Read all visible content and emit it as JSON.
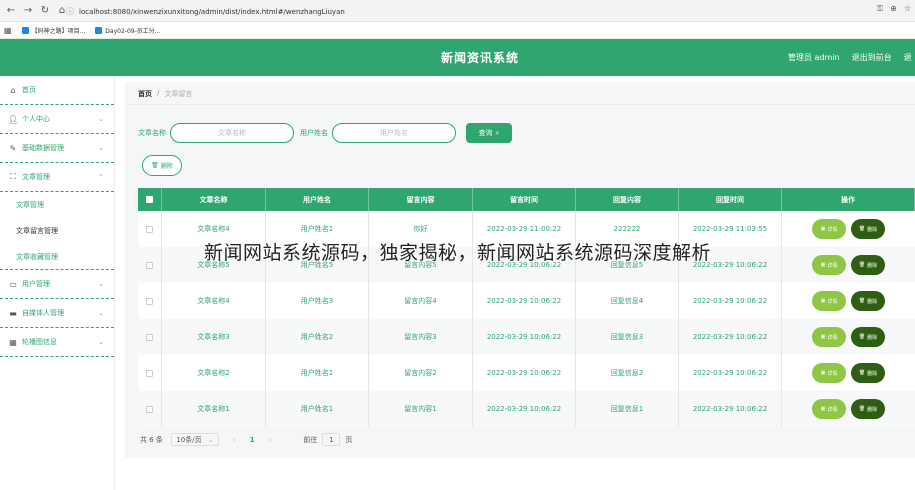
{
  "browser": {
    "url": "localhost:8080/xinwenzixunxitong/admin/dist/index.html#/wenzhangLiuyan",
    "bookmarks": [
      "【码神之路】项目...",
      "Day02-09-员工分..."
    ]
  },
  "header": {
    "title": "新闻资讯系统",
    "admin": "管理员 admin",
    "back_to_front": "退出到前台",
    "logout": "退"
  },
  "sidebar": {
    "items": [
      {
        "label": "首页",
        "icon": "home-icon"
      },
      {
        "label": "个人中心",
        "icon": "user-icon"
      },
      {
        "label": "基础数据管理",
        "icon": "edit-icon"
      },
      {
        "label": "文章管理",
        "icon": "expand-icon"
      },
      {
        "label": "用户管理",
        "icon": "monitor-icon"
      },
      {
        "label": "自媒体人管理",
        "icon": "media-icon"
      },
      {
        "label": "轮播图信息",
        "icon": "grid-icon"
      }
    ],
    "sub_items": [
      "文章管理",
      "文章留言管理",
      "文章收藏管理"
    ]
  },
  "breadcrumb": {
    "home": "首页",
    "sep": "/",
    "current": "文章留言"
  },
  "search": {
    "article_label": "文章名称",
    "article_placeholder": "文章名称",
    "user_label": "用户姓名",
    "user_placeholder": "用户姓名",
    "button": "查询"
  },
  "delete_button": "删除",
  "table": {
    "headers": [
      "文章名称",
      "用户姓名",
      "留言内容",
      "留言时间",
      "回复内容",
      "回复时间",
      "操作"
    ],
    "rows": [
      [
        "文章名称4",
        "用户姓名1",
        "你好",
        "2022-03-29 11:00:22",
        "222222",
        "2022-03-29 11:03:55"
      ],
      [
        "文章名称5",
        "用户姓名5",
        "留言内容5",
        "2022-03-29 10:06:22",
        "回复信息5",
        "2022-03-29 10:06:22"
      ],
      [
        "文章名称4",
        "用户姓名3",
        "留言内容4",
        "2022-03-29 10:06:22",
        "回复信息4",
        "2022-03-29 10:06:22"
      ],
      [
        "文章名称3",
        "用户姓名2",
        "留言内容3",
        "2022-03-29 10:06:22",
        "回复信息3",
        "2022-03-29 10:06:22"
      ],
      [
        "文章名称2",
        "用户姓名1",
        "留言内容2",
        "2022-03-29 10:06:22",
        "回复信息2",
        "2022-03-29 10:06:22"
      ],
      [
        "文章名称1",
        "用户姓名1",
        "留言内容1",
        "2022-03-29 10:06:22",
        "回复信息1",
        "2022-03-29 10:06:22"
      ]
    ],
    "detail_label": "详情",
    "delete_label": "删除"
  },
  "pagination": {
    "total": "共 6 条",
    "page_size": "10条/页",
    "current": "1",
    "goto_label": "前往",
    "goto_value": "1",
    "page_unit": "页"
  },
  "overlay_text": "新闻网站系统源码，独家揭秘，新闻网站系统源码深度解析",
  "colors": {
    "primary": "#2fa56f",
    "detail": "#8fc744",
    "delete": "#2e5e14"
  }
}
